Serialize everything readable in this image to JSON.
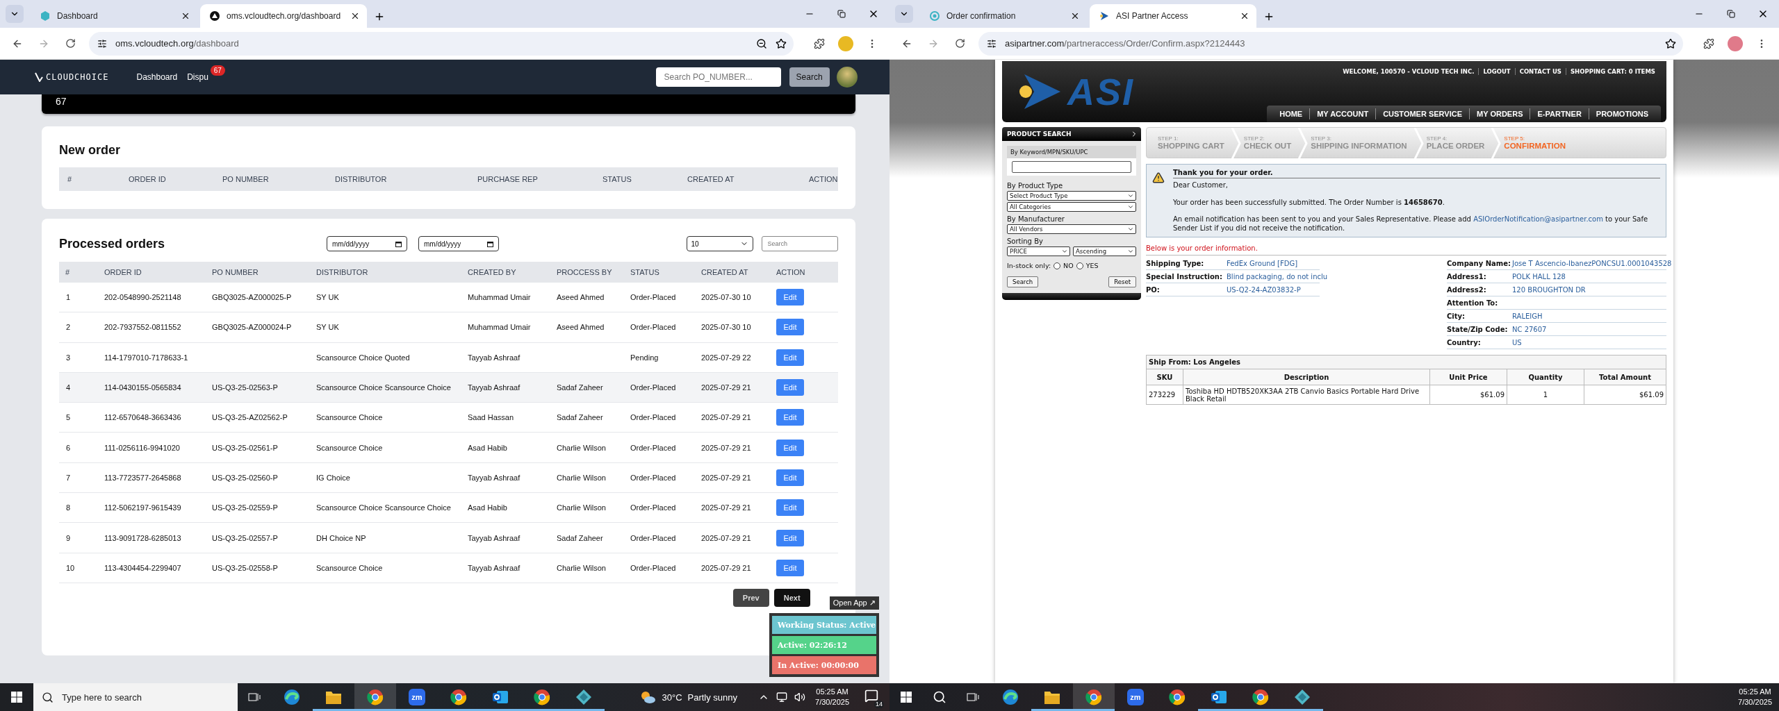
{
  "browsers": [
    {
      "tabs": [
        {
          "title": "Dashboard",
          "selected": false,
          "kind": "hex"
        },
        {
          "title": "oms.vcloudtech.org/dashboard",
          "selected": true,
          "kind": "triangle"
        }
      ],
      "url_host": "oms.vcloudtech.org",
      "url_path": "/dashboard",
      "zoom_indicator": true
    },
    {
      "tabs": [
        {
          "title": "Order confirmation",
          "selected": false,
          "kind": "ring"
        },
        {
          "title": "ASI Partner Access",
          "selected": true,
          "kind": "arrow"
        }
      ],
      "url_host": "asipartner.com",
      "url_path": "/partneraccess/Order/Confirm.aspx?2124443",
      "zoom_indicator": false
    }
  ],
  "oms": {
    "brand": "CLOUDCHOICE",
    "nav": [
      {
        "label": "Dashboard"
      },
      {
        "label": "Dispu",
        "badge": "67"
      }
    ],
    "search_placeholder": "Search PO_NUMBER...",
    "search_button": "Search",
    "banner_value": "67",
    "new_order": {
      "title": "New order",
      "columns": [
        "#",
        "ORDER ID",
        "PO NUMBER",
        "DISTRIBUTOR",
        "PURCHASE REP",
        "STATUS",
        "CREATED AT",
        "ACTION"
      ]
    },
    "processed": {
      "title": "Processed orders",
      "date_placeholders": [
        "mm/dd/yyyy",
        "mm/dd/yyyy"
      ],
      "page_size": "10",
      "search_placeholder": "Search",
      "columns": [
        "#",
        "ORDER ID",
        "PO NUMBER",
        "DISTRIBUTOR",
        "CREATED BY",
        "PROCCESS BY",
        "STATUS",
        "CREATED AT",
        "ACTION"
      ],
      "rows": [
        {
          "cells": [
            "1",
            "202-0548990-2521148",
            "GBQ3025-AZ000025-P",
            "SY UK",
            "Muhammad Umair",
            "Aseed Ahmed",
            "Order-Placed",
            "2025-07-30 10"
          ],
          "action": "Edit",
          "highlighted": false
        },
        {
          "cells": [
            "2",
            "202-7937552-0811552",
            "GBQ3025-AZ000024-P",
            "SY UK",
            "Muhammad Umair",
            "Aseed Ahmed",
            "Order-Placed",
            "2025-07-30 10"
          ],
          "action": "Edit",
          "highlighted": false
        },
        {
          "cells": [
            "3",
            "114-1797010-7178633-1",
            null,
            "Scansource Choice Quoted",
            "Tayyab Ashraaf",
            null,
            "Pending",
            "2025-07-29 22"
          ],
          "action": "Edit",
          "highlighted": false
        },
        {
          "cells": [
            "4",
            "114-0430155-0565834",
            "US-Q3-25-02563-P",
            "Scansource Choice Scansource Choice",
            "Tayyab Ashraaf",
            "Sadaf Zaheer",
            "Order-Placed",
            "2025-07-29 21"
          ],
          "action": "Edit",
          "highlighted": true
        },
        {
          "cells": [
            "5",
            "112-6570648-3663436",
            "US-Q3-25-AZ02562-P",
            "Scansource Choice",
            "Saad Hassan",
            "Sadaf Zaheer",
            "Order-Placed",
            "2025-07-29 21"
          ],
          "action": "Edit",
          "highlighted": false
        },
        {
          "cells": [
            "6",
            "111-0256116-9941020",
            "US-Q3-25-02561-P",
            "Scansource Choice",
            "Asad Habib",
            "Charlie Wilson",
            "Order-Placed",
            "2025-07-29 21"
          ],
          "action": "Edit",
          "highlighted": false
        },
        {
          "cells": [
            "7",
            "113-7723577-2645868",
            "US-Q3-25-02560-P",
            "IG Choice",
            "Tayyab Ashraaf",
            "Charlie Wilson",
            "Order-Placed",
            "2025-07-29 21"
          ],
          "action": "Edit",
          "highlighted": false
        },
        {
          "cells": [
            "8",
            "112-5062197-9615439",
            "US-Q3-25-02559-P",
            "Scansource Choice Scansource Choice",
            "Asad Habib",
            "Charlie Wilson",
            "Order-Placed",
            "2025-07-29 21"
          ],
          "action": "Edit",
          "highlighted": false
        },
        {
          "cells": [
            "9",
            "113-9091728-6285013",
            "US-Q3-25-02557-P",
            "DH Choice NP",
            "Tayyab Ashraaf",
            "Sadaf Zaheer",
            "Order-Placed",
            "2025-07-29 21"
          ],
          "action": "Edit",
          "highlighted": false
        },
        {
          "cells": [
            "10",
            "113-4304454-2299407",
            "US-Q3-25-02558-P",
            "Scansource Choice",
            "Tayyab Ashraaf",
            "Charlie Wilson",
            "Order-Placed",
            "2025-07-29 21"
          ],
          "action": "Edit",
          "highlighted": false
        }
      ],
      "prev": "Prev",
      "next": "Next"
    },
    "widget": {
      "open_app": "Open App ↗",
      "items": [
        {
          "kind": "status",
          "text": "Working Status: Active"
        },
        {
          "kind": "active",
          "text": "Active: 02:26:12"
        },
        {
          "kind": "inactive",
          "text": "In Active: 00:00:00"
        }
      ]
    }
  },
  "asi": {
    "logo": "ASI",
    "top_links": [
      "WELCOME, 100570 - VCLOUD TECH INC.",
      "LOGOUT",
      "CONTACT US",
      "SHOPPING CART: 0 ITEMS"
    ],
    "nav": [
      "HOME",
      "MY ACCOUNT",
      "CUSTOMER SERVICE",
      "MY ORDERS",
      "E-PARTNER",
      "PROMOTIONS"
    ],
    "sidebar": {
      "title": "PRODUCT SEARCH",
      "keyword_label": "By Keyword/MPN/SKU/UPC",
      "product_type_label": "By Product Type",
      "type_selects": [
        "Select Product Type",
        "All Categories"
      ],
      "manufacturer_label": "By Manufacturer",
      "vendor_select": "All Vendors",
      "sorting_label": "Sorting By",
      "sort_selects": [
        "PRICE",
        "Ascending"
      ],
      "instock_label": "In-stock only:",
      "instock_options": [
        {
          "label": "NO",
          "selected": false
        },
        {
          "label": "YES",
          "selected": false
        }
      ],
      "search_button": "Search",
      "reset_button": "Reset"
    },
    "steps": [
      {
        "number": "STEP 1:",
        "label": "SHOPPING CART",
        "selected": false
      },
      {
        "number": "STEP 2:",
        "label": "CHECK OUT",
        "selected": false
      },
      {
        "number": "STEP 3:",
        "label": "SHIPPING INFORMATION",
        "selected": false
      },
      {
        "number": "STEP 4:",
        "label": "PLACE ORDER",
        "selected": false
      },
      {
        "number": "STEP 5:",
        "label": "CONFIRMATION",
        "selected": true
      }
    ],
    "message": {
      "title": "Thank you for your order.",
      "greeting": "Dear Customer,",
      "order_text": "Your order has been successfully submitted. The Order Number is **14658670**.",
      "email_before": "An email notification has been sent to you and your Sales Representative. Please add",
      "email_link": "ASIOrderNotification@asipartner.com",
      "email_after": "to your Safe Sender List if you did not receive the notification."
    },
    "info_heading": "Below is your order information.",
    "shipping_fields": [
      {
        "label": "Shipping Type:",
        "value": "FedEx Ground [FDG]"
      },
      {
        "label": "Special Instruction:",
        "value": "Blind packaging, do not inclu"
      },
      {
        "label": "PO:",
        "value": "US-Q2-24-AZ03832-P"
      }
    ],
    "address_fields": [
      {
        "label": "Company Name:",
        "value": "Jose T Ascencio-IbanezPONCSU1.0001043528"
      },
      {
        "label": "Address1:",
        "value": "POLK HALL 128"
      },
      {
        "label": "Address2:",
        "value": "120 BROUGHTON DR"
      },
      {
        "label": "Attention To:"
      },
      {
        "label": "City:",
        "value": "RALEIGH"
      },
      {
        "label": "State/Zip Code:",
        "value": "NC 27607"
      },
      {
        "label": "Country:",
        "value": "US"
      }
    ],
    "ship_from": "Ship From: Los Angeles",
    "items_table": {
      "columns": [
        "SKU",
        "Description",
        "Unit Price",
        "Quantity",
        "Total Amount"
      ],
      "rows": [
        [
          "273229",
          "Toshiba HD HDTB520XK3AA 2TB Canvio Basics Portable Hard Drive Black Retail",
          "$61.09",
          "1",
          "$61.09"
        ]
      ]
    }
  },
  "taskbars": [
    {
      "search_placeholder": "Type here to search",
      "weather_temp": "30°C",
      "weather_text": "Partly sunny",
      "time": "05:25 AM",
      "date": "7/30/2025",
      "notifications": "14",
      "apps": [
        {
          "kind": "swirl",
          "open": false,
          "active": false
        },
        {
          "kind": "folder",
          "open": true,
          "active": false
        },
        {
          "kind": "browser",
          "open": true,
          "active": true
        },
        {
          "kind": "letters",
          "open": true,
          "active": false,
          "label": "zm"
        },
        {
          "kind": "browser",
          "open": true,
          "active": false
        },
        {
          "kind": "mail",
          "open": true,
          "active": false
        },
        {
          "kind": "browser",
          "open": true,
          "active": false
        },
        {
          "kind": "diamond",
          "open": true,
          "active": false
        }
      ]
    },
    {
      "time": "05:25 AM",
      "date": "7/30/2025",
      "apps": [
        {
          "kind": "swirl",
          "open": false,
          "active": false
        },
        {
          "kind": "folder",
          "open": true,
          "active": false
        },
        {
          "kind": "browser",
          "open": true,
          "active": true
        },
        {
          "kind": "letters",
          "open": false,
          "active": false,
          "label": "zm"
        },
        {
          "kind": "browser",
          "open": false,
          "active": false
        },
        {
          "kind": "mail",
          "open": true,
          "active": false
        },
        {
          "kind": "browser",
          "open": true,
          "active": false
        },
        {
          "kind": "diamond",
          "open": true,
          "active": false
        }
      ]
    }
  ]
}
